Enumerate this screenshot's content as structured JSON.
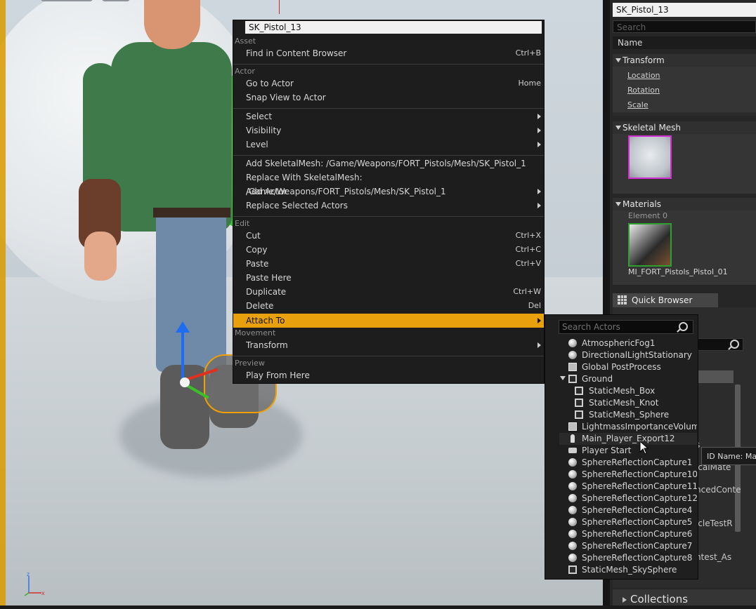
{
  "viewport": {},
  "details": {
    "object_name": "SK_Pistol_13",
    "search_placeholder": "Search",
    "column_header": "Name",
    "transform": {
      "title": "Transform",
      "location": "Location",
      "rotation": "Rotation",
      "scale": "Scale"
    },
    "skeletal_mesh": {
      "title": "Skeletal Mesh"
    },
    "materials": {
      "title": "Materials",
      "element": "Element 0",
      "material_name": "MI_FORT_Pistols_Pistol_01"
    },
    "quick_browser": {
      "tab": "Quick Browser",
      "partial_texts": [
        "s",
        "icalMate",
        "ncedConte",
        "icleTestR",
        "ntest_As"
      ]
    },
    "tooltip": "ID Name: Main",
    "collections": "Collections"
  },
  "context_menu": {
    "title": "SK_Pistol_13",
    "sections": {
      "asset": "Asset",
      "actor": "Actor",
      "edit": "Edit",
      "movement": "Movement",
      "preview": "Preview"
    },
    "items": {
      "find_in_cb": {
        "label": "Find in Content Browser",
        "shortcut": "Ctrl+B"
      },
      "go_to_actor": {
        "label": "Go to Actor",
        "shortcut": "Home"
      },
      "snap_view": {
        "label": "Snap View to Actor"
      },
      "select": {
        "label": "Select"
      },
      "visibility": {
        "label": "Visibility"
      },
      "level": {
        "label": "Level"
      },
      "add_skel": {
        "label": "Add SkeletalMesh: /Game/Weapons/FORT_Pistols/Mesh/SK_Pistol_1"
      },
      "replace_skel": {
        "label": "Replace With SkeletalMesh: /Game/Weapons/FORT_Pistols/Mesh/SK_Pistol_1"
      },
      "add_actor": {
        "label": "Add Actor"
      },
      "replace_selected": {
        "label": "Replace Selected Actors"
      },
      "cut": {
        "label": "Cut",
        "shortcut": "Ctrl+X"
      },
      "copy": {
        "label": "Copy",
        "shortcut": "Ctrl+C"
      },
      "paste": {
        "label": "Paste",
        "shortcut": "Ctrl+V"
      },
      "paste_here": {
        "label": "Paste Here"
      },
      "duplicate": {
        "label": "Duplicate",
        "shortcut": "Ctrl+W"
      },
      "delete": {
        "label": "Delete",
        "shortcut": "Del"
      },
      "attach_to": {
        "label": "Attach To"
      },
      "transform": {
        "label": "Transform"
      },
      "play_from_here": {
        "label": "Play From Here"
      }
    },
    "highlight_color": "#e8a00c"
  },
  "attach_submenu": {
    "search_placeholder": "Search Actors",
    "actors": [
      {
        "label": "AtmosphericFog1",
        "icon": "sphere-icon"
      },
      {
        "label": "DirectionalLightStationary",
        "icon": "directional-light-icon"
      },
      {
        "label": "Global PostProcess",
        "icon": "postprocess-volume-icon"
      },
      {
        "label": "Ground",
        "icon": "static-mesh-icon"
      },
      {
        "label": "StaticMesh_Box",
        "icon": "static-mesh-icon"
      },
      {
        "label": "StaticMesh_Knot",
        "icon": "static-mesh-icon"
      },
      {
        "label": "StaticMesh_Sphere",
        "icon": "static-mesh-icon"
      },
      {
        "label": "LightmassImportanceVolume",
        "icon": "volume-icon"
      },
      {
        "label": "Main_Player_Export12",
        "icon": "player-icon"
      },
      {
        "label": "Player Start",
        "icon": "player-start-icon"
      },
      {
        "label": "SphereReflectionCapture1",
        "icon": "sphere-icon"
      },
      {
        "label": "SphereReflectionCapture10",
        "icon": "sphere-icon"
      },
      {
        "label": "SphereReflectionCapture11",
        "icon": "sphere-icon"
      },
      {
        "label": "SphereReflectionCapture12",
        "icon": "sphere-icon"
      },
      {
        "label": "SphereReflectionCapture4",
        "icon": "sphere-icon"
      },
      {
        "label": "SphereReflectionCapture5",
        "icon": "sphere-icon"
      },
      {
        "label": "SphereReflectionCapture6",
        "icon": "sphere-icon"
      },
      {
        "label": "SphereReflectionCapture7",
        "icon": "sphere-icon"
      },
      {
        "label": "SphereReflectionCapture8",
        "icon": "sphere-icon"
      },
      {
        "label": "StaticMesh_SkySphere",
        "icon": "static-mesh-icon"
      }
    ]
  }
}
